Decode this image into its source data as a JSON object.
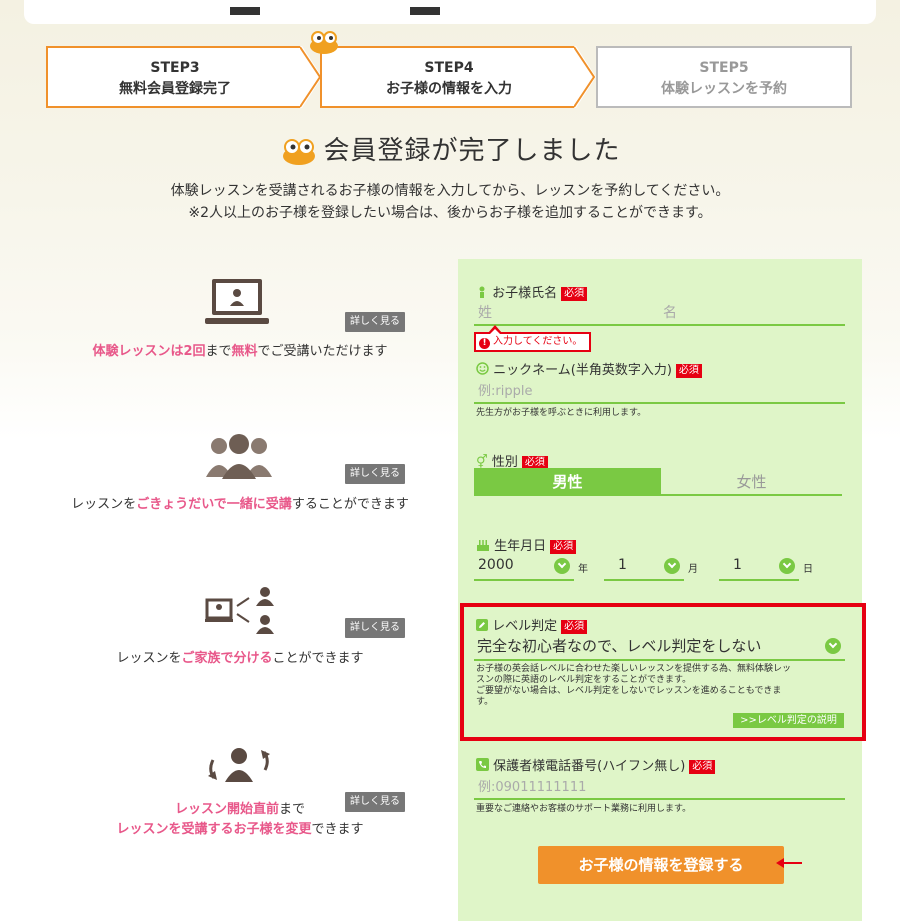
{
  "steps": [
    {
      "num": "STEP3",
      "label": "無料会員登録完了"
    },
    {
      "num": "STEP4",
      "label": "お子様の情報を入力"
    },
    {
      "num": "STEP5",
      "label": "体験レッスンを予約"
    }
  ],
  "title": "会員登録が完了しました",
  "desc_line1": "体験レッスンを受講されるお子様の情報を入力してから、レッスンを予約してください。",
  "desc_line2": "※2人以上のお子様を登録したい場合は、後からお子様を追加することができます。",
  "features": [
    {
      "parts": [
        {
          "t": "体験レッスンは2回",
          "hl": true
        },
        {
          "t": "まで",
          "hl": false
        },
        {
          "t": "無料",
          "hl": true
        },
        {
          "t": "でご受講いただけます",
          "hl": false
        }
      ]
    },
    {
      "parts": [
        {
          "t": "レッスンを",
          "hl": false
        },
        {
          "t": "ごきょうだいで一緒に受講",
          "hl": true
        },
        {
          "t": "することができます",
          "hl": false
        }
      ]
    },
    {
      "parts": [
        {
          "t": "レッスンを",
          "hl": false
        },
        {
          "t": "ご家族で分ける",
          "hl": true
        },
        {
          "t": "ことができます",
          "hl": false
        }
      ]
    },
    {
      "line1": [
        {
          "t": "レッスン開始直前",
          "hl": true
        },
        {
          "t": "まで",
          "hl": false
        }
      ],
      "line2": [
        {
          "t": "レッスンを受講するお子様を変更",
          "hl": true
        },
        {
          "t": "できます",
          "hl": false
        }
      ]
    }
  ],
  "more_label": "詳しく見る",
  "required_label": "必須",
  "form": {
    "name_label": "お子様氏名",
    "last_placeholder": "姓",
    "first_placeholder": "名",
    "error_text": "入力してください。",
    "nick_label": "ニックネーム(半角英数字入力)",
    "nick_placeholder": "例:ripple",
    "nick_note": "先生方がお子様を呼ぶときに利用します。",
    "gender_label": "性別",
    "gender_male": "男性",
    "gender_female": "女性",
    "birth_label": "生年月日",
    "year": "2000",
    "year_unit": "年",
    "month": "1",
    "month_unit": "月",
    "day": "1",
    "day_unit": "日",
    "level_label": "レベル判定",
    "level_value": "完全な初心者なので、レベル判定をしない",
    "level_note1": "お子様の英会話レベルに合わせた楽しいレッスンを提供する為、無料体験レッ",
    "level_note2": "スンの際に英語のレベル判定をすることができます。",
    "level_note3": "ご要望がない場合は、レベル判定をしないでレッスンを進めることもできま",
    "level_note4": "す。",
    "level_explain": ">>レベル判定の説明",
    "phone_label": "保護者様電話番号(ハイフン無し)",
    "phone_placeholder": "例:09011111111",
    "phone_note": "重要なご連絡やお客様のサポート業務に利用します。",
    "submit": "お子様の情報を登録する"
  },
  "colors": {
    "orange": "#f0912b",
    "green": "#7ac943",
    "panel": "#dff5c8",
    "red": "#e60012",
    "pink": "#e8588a"
  }
}
